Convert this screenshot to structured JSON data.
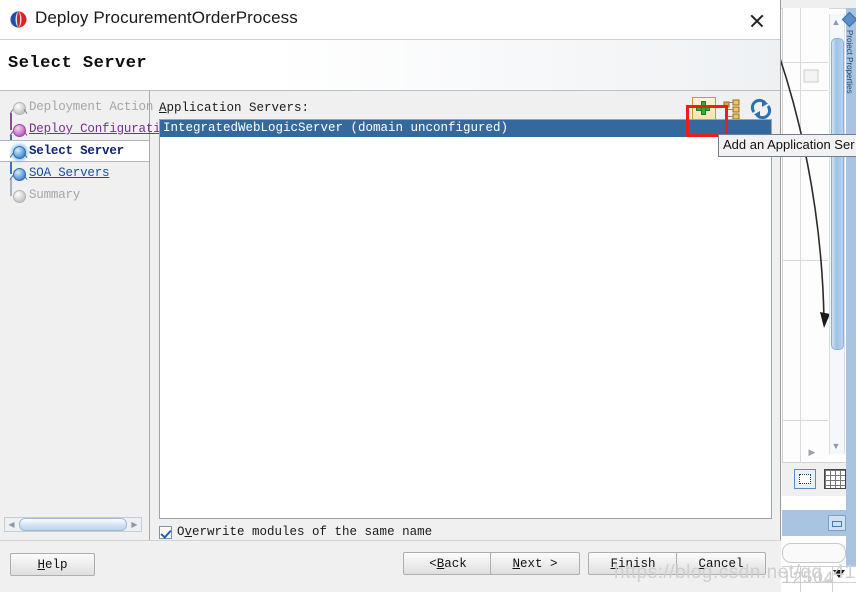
{
  "window": {
    "title": "Deploy ProcurementOrderProcess",
    "icon": "oracle-logo-icon",
    "close_label": "×"
  },
  "header": {
    "title": "Select Server"
  },
  "sidebar": {
    "steps": [
      {
        "label": "Deployment Action",
        "state": "disabled",
        "node": "gray"
      },
      {
        "label": "Deploy Configuration",
        "state": "visited",
        "node": "purple"
      },
      {
        "label": "Select Server",
        "state": "current",
        "node": "blue"
      },
      {
        "label": "SOA Servers",
        "state": "link",
        "node": "blue"
      },
      {
        "label": "Summary",
        "state": "disabled",
        "node": "gray"
      }
    ],
    "scrollbar": {
      "left_arrow": "◀",
      "right_arrow": "▶"
    }
  },
  "main": {
    "label_prefix": "A",
    "label_rest": "pplication Servers:",
    "toolbar": [
      {
        "name": "add-application-server-icon",
        "title": "Add an Application Server"
      },
      {
        "name": "edit-application-server-icon",
        "title": "Edit"
      },
      {
        "name": "refresh-application-server-icon",
        "title": "Refresh"
      }
    ],
    "tooltip": "Add an Application Ser",
    "servers": [
      {
        "label": "IntegratedWebLogicServer (domain unconfigured)",
        "selected": true
      }
    ],
    "checkbox": {
      "checked": true,
      "prefix": "O",
      "mnemonic": "v",
      "suffix": "erwrite modules of the same name"
    }
  },
  "footer": {
    "buttons": [
      {
        "name": "help-button",
        "pre": "",
        "mn": "H",
        "post": "elp"
      },
      {
        "name": "back-button",
        "pre": "< ",
        "mn": "B",
        "post": "ack"
      },
      {
        "name": "next-button",
        "pre": "",
        "mn": "N",
        "post": "ext >"
      },
      {
        "name": "finish-button",
        "pre": "",
        "mn": "F",
        "post": "inish"
      },
      {
        "name": "cancel-button",
        "pre": "",
        "mn": "C",
        "post": "ancel"
      }
    ]
  },
  "background": {
    "watermark": "https://blog.csdn.net/qq_412504",
    "watermark_right": "12504",
    "vertical_tab_text": "Proiect Properties",
    "canvas_icons": [
      {
        "name": "selection-tool-icon"
      },
      {
        "name": "grid-toggle-icon"
      }
    ]
  },
  "colors": {
    "selection_blue": "#35689d",
    "accent_red": "#ef1c1c",
    "link_purple": "#7b2d8e",
    "link_blue": "#1a4fa0",
    "current_step": "#10256e"
  }
}
